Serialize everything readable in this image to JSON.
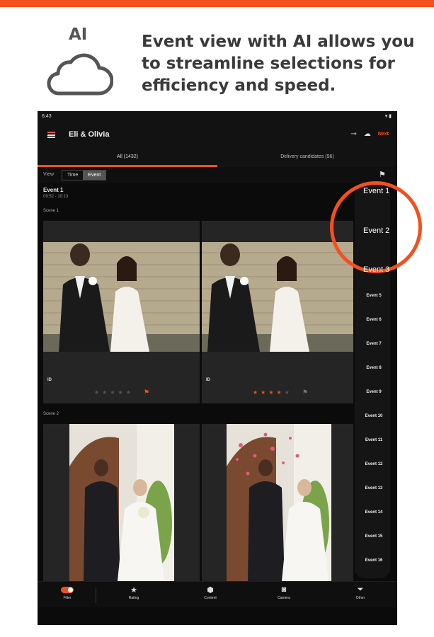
{
  "colors": {
    "accent": "#f4501e",
    "device_bg": "#0b0b0b",
    "heading": "#3a3a3a"
  },
  "promo": {
    "ai_label": "AI",
    "icon": "cloud-icon",
    "headline": "Event view with AI allows you to streamline selections for efficiency and speed."
  },
  "status_bar": {
    "time": "6:43",
    "icons": "▾ ▮"
  },
  "app_bar": {
    "title": "Eli & Olivia",
    "next_label": "Next",
    "icons": [
      "menu-icon",
      "link-icon",
      "cloud-icon"
    ]
  },
  "tabs": [
    {
      "label": "All (1432)",
      "selected": true
    },
    {
      "label": "Delivery candidates (96)",
      "selected": false
    }
  ],
  "view_row": {
    "label": "View",
    "options": [
      "Time",
      "Event"
    ],
    "selected": "Event",
    "right_icon": "flag-filter-icon"
  },
  "event": {
    "title": "Event 1",
    "time": "09:52 - 10:13"
  },
  "scenes": [
    {
      "label": "Scene 1",
      "cards": [
        {
          "tag": "ID",
          "rating": 0,
          "flag": "orange"
        },
        {
          "tag": "ID",
          "rating": 4,
          "flag": "gray"
        }
      ]
    },
    {
      "label": "Scene 2",
      "cards": [
        {},
        {}
      ]
    }
  ],
  "event_rail": {
    "highlighted": [
      "Event 1",
      "Event 2",
      "Event 3"
    ],
    "items": [
      "Event 5",
      "Event 6",
      "Event 7",
      "Event 8",
      "Event 9",
      "Event 10",
      "Event 11",
      "Event 12",
      "Event 13",
      "Event 14",
      "Event 15",
      "Event 16"
    ]
  },
  "bottom_nav": [
    {
      "label": "Filter",
      "icon": "toggle-icon"
    },
    {
      "label": "Rating",
      "icon": "star-icon"
    },
    {
      "label": "Content",
      "icon": "cube-icon"
    },
    {
      "label": "Camera",
      "icon": "camera-icon"
    },
    {
      "label": "Other",
      "icon": "funnel-icon"
    }
  ]
}
